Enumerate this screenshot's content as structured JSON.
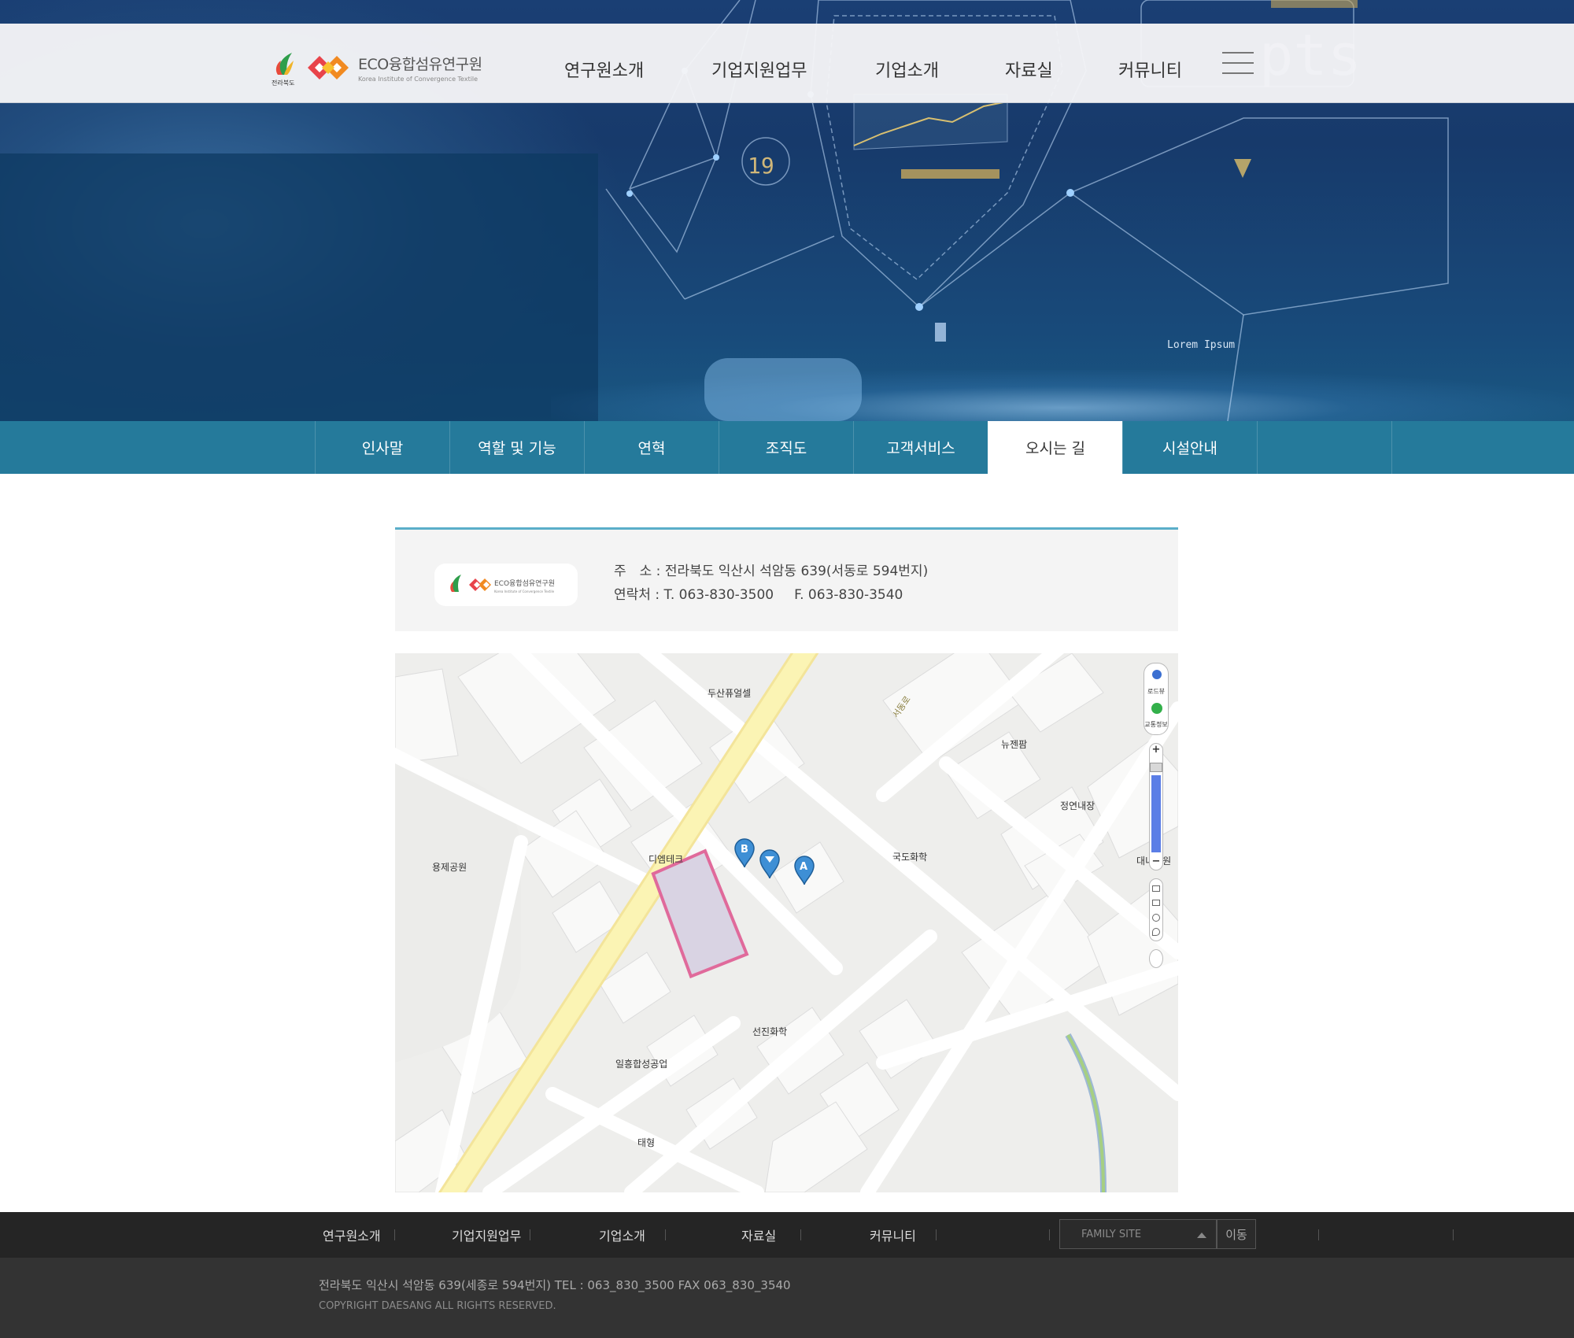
{
  "header": {
    "province_logo_text": "전라북도",
    "org_name": "ECO융합섬유연구원",
    "org_name_en": "Korea Institute of Convergence Textile",
    "gnb": [
      "연구원소개",
      "기업지원업무",
      "기업소개",
      "자료실",
      "커뮤니티"
    ]
  },
  "hero_graphic": {
    "pts_text": "pts",
    "counter": "19",
    "caption": "Lorem Ipsum"
  },
  "subnav": {
    "items": [
      "인사말",
      "역할 및 기능",
      "연혁",
      "조직도",
      "고객서비스",
      "오시는 길",
      "시설안내"
    ],
    "active": "오시는 길"
  },
  "info": {
    "address_label": "주　소 :",
    "address": "전라북도 익산시 석암동 639(서동로 594번지)",
    "contact_label": "연락처 :",
    "tel": "T.  063-830-3500",
    "fax": "F.  063-830-3540"
  },
  "map": {
    "labels": [
      "두산퓨얼셀",
      "서동로",
      "뉴젠팜",
      "정연내장",
      "용제공원",
      "디엠테크",
      "국도화학",
      "선진화학",
      "일흥합성공업",
      "태형",
      "대니공원"
    ],
    "markers": [
      "B",
      "A"
    ],
    "controls": {
      "roadview": "로드뷰",
      "traffic": "교통정보",
      "zoom_in": "+",
      "zoom_out": "−"
    },
    "colors": {
      "main_road": "#fbf4b4",
      "site_outline": "#e06a9b",
      "marker": "#3e8fd5"
    }
  },
  "footer": {
    "menu": [
      "연구원소개",
      "기업지원업무",
      "기업소개",
      "자료실",
      "커뮤니티"
    ],
    "family_site": "FAMILY SITE",
    "move_button": "이동",
    "address_line": "전라북도 익산시 석암동 639(세종로 594번지)    TEL : 063_830_3500    FAX   063_830_3540",
    "copyright": "COPYRIGHT DAESANG ALL RIGHTS RESERVED."
  }
}
